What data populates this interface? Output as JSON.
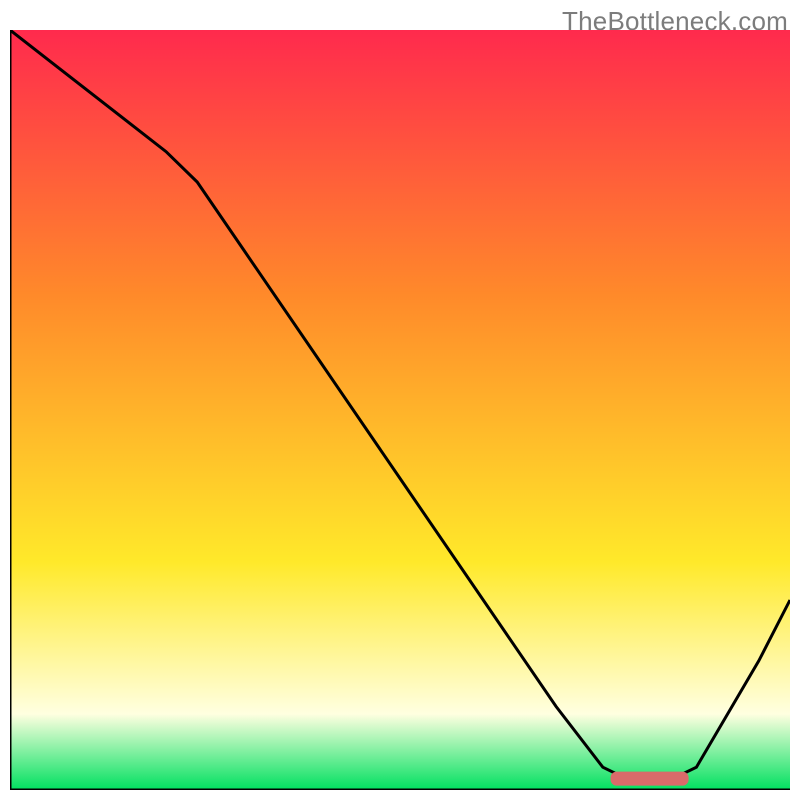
{
  "watermark": "TheBottleneck.com",
  "colors": {
    "gradient_top": "#ff2a4d",
    "gradient_mid1": "#ff8a2a",
    "gradient_mid2": "#ffe92a",
    "gradient_pale": "#ffffe0",
    "gradient_bottom": "#00e060",
    "axis": "#000000",
    "curve": "#000000",
    "marker_fill": "#d96a6a"
  },
  "chart_data": {
    "type": "line",
    "title": "",
    "xlabel": "",
    "ylabel": "",
    "xlim": [
      0,
      100
    ],
    "ylim": [
      0,
      100
    ],
    "marker": {
      "x_center": 82,
      "width": 10,
      "y": 1.5
    },
    "series": [
      {
        "name": "curve",
        "x": [
          0,
          5,
          10,
          15,
          20,
          24,
          30,
          40,
          50,
          60,
          70,
          76,
          80,
          84,
          88,
          92,
          96,
          100
        ],
        "y": [
          100,
          96,
          92,
          88,
          84,
          80,
          71,
          56,
          41,
          26,
          11,
          3,
          1,
          1,
          3,
          10,
          17,
          25
        ]
      }
    ]
  }
}
